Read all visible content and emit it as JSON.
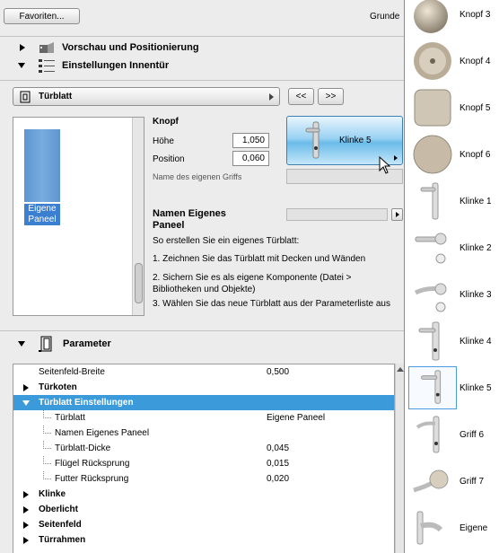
{
  "topbar": {
    "favorites_label": "Favoriten...",
    "right_label": "Grunde"
  },
  "sections": {
    "preview": {
      "label": "Vorschau und Positionierung",
      "icon": "preview-icon"
    },
    "settings": {
      "label": "Einstellungen Innentür",
      "icon": "settings-icon"
    },
    "params": {
      "label": "Parameter",
      "icon": "door-icon"
    }
  },
  "selector": {
    "value": "Türblatt",
    "prev_label": "<<",
    "next_label": ">>"
  },
  "panel_preview": {
    "caption_line1": "Eigene",
    "caption_line2": "Paneel"
  },
  "knopf": {
    "title": "Knopf",
    "hoehe_label": "Höhe",
    "hoehe_value": "1,050",
    "position_label": "Position",
    "position_value": "0,060",
    "griff_name_label": "Name des eigenen Griffs",
    "selected_handle": "Klinke 5"
  },
  "custom_panel": {
    "title_line1": "Namen Eigenes",
    "title_line2": "Paneel",
    "intro": "So erstellen Sie ein eigenes Türblatt:",
    "step1": "1. Zeichnen Sie das Türblatt mit Decken und Wänden",
    "step2a": "2. Sichern Sie es als eigene Komponente (Datei >",
    "step2b": "Bibliotheken und Objekte)",
    "step3": "3. Wählen Sie das neue Türblatt aus der Parameterliste aus"
  },
  "parameters": [
    {
      "name": "Seitenfeld-Breite",
      "value": "0,500"
    },
    {
      "name": "Türkoten",
      "value": ""
    },
    {
      "name": "Türblatt Einstellungen",
      "value": ""
    },
    {
      "name": "Türblatt",
      "value": "Eigene Paneel"
    },
    {
      "name": "Namen Eigenes Paneel",
      "value": ""
    },
    {
      "name": "Türblatt-Dicke",
      "value": "0,045"
    },
    {
      "name": "Flügel Rücksprung",
      "value": "0,015"
    },
    {
      "name": "Futter Rücksprung",
      "value": "0,020"
    },
    {
      "name": "Klinke",
      "value": ""
    },
    {
      "name": "Oberlicht",
      "value": ""
    },
    {
      "name": "Seitenfeld",
      "value": ""
    },
    {
      "name": "Türrahmen",
      "value": ""
    }
  ],
  "handle_options": [
    {
      "label": "Knopf 3",
      "icon": "knob-icon"
    },
    {
      "label": "Knopf 4",
      "icon": "knob-lock-icon"
    },
    {
      "label": "Knopf 5",
      "icon": "square-knob-icon"
    },
    {
      "label": "Knopf 6",
      "icon": "round-knob-icon"
    },
    {
      "label": "Klinke 1",
      "icon": "lever-plate-icon"
    },
    {
      "label": "Klinke 2",
      "icon": "lever-rose-icon"
    },
    {
      "label": "Klinke 3",
      "icon": "lever-rose-icon"
    },
    {
      "label": "Klinke 4",
      "icon": "lever-plate-icon"
    },
    {
      "label": "Klinke 5",
      "icon": "lever-plate-icon"
    },
    {
      "label": "Griff 6",
      "icon": "lever-plate-icon"
    },
    {
      "label": "Griff 7",
      "icon": "lever-knob-icon"
    },
    {
      "label": "Eigene",
      "icon": "custom-handle-icon"
    }
  ],
  "colors": {
    "selection": "#3b9ad9",
    "handle_button": "#7cc0ea",
    "panel_blue": "#6a9fd4"
  }
}
